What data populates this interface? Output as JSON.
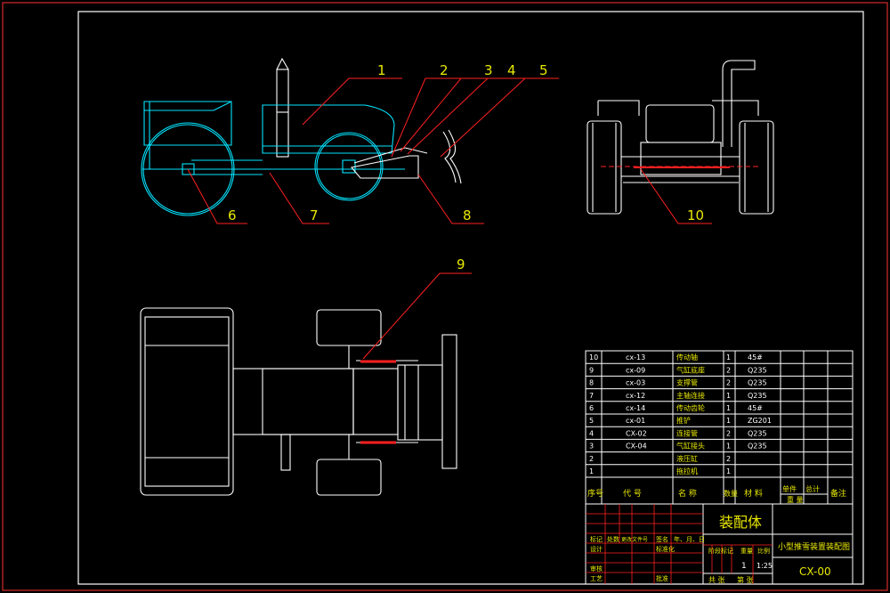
{
  "balloons": [
    {
      "label": "1"
    },
    {
      "label": "2"
    },
    {
      "label": "3"
    },
    {
      "label": "4"
    },
    {
      "label": "5"
    },
    {
      "label": "6"
    },
    {
      "label": "7"
    },
    {
      "label": "8"
    },
    {
      "label": "9"
    },
    {
      "label": "10"
    }
  ],
  "bom": {
    "rows": [
      {
        "seq": "10",
        "code": "cx-13",
        "name": "传动轴",
        "qty": "1",
        "material": "45#"
      },
      {
        "seq": "9",
        "code": "cx-09",
        "name": "气缸底座",
        "qty": "2",
        "material": "Q235"
      },
      {
        "seq": "8",
        "code": "cx-03",
        "name": "支撑管",
        "qty": "2",
        "material": "Q235"
      },
      {
        "seq": "7",
        "code": "cx-12",
        "name": "主轴连接",
        "qty": "1",
        "material": "Q235"
      },
      {
        "seq": "6",
        "code": "cx-14",
        "name": "传动齿轮",
        "qty": "1",
        "material": "45#"
      },
      {
        "seq": "5",
        "code": "cx-01",
        "name": "推铲",
        "qty": "1",
        "material": "ZG201"
      },
      {
        "seq": "4",
        "code": "CX-02",
        "name": "连接管",
        "qty": "2",
        "material": "Q235"
      },
      {
        "seq": "3",
        "code": "CX-04",
        "name": "气缸接头",
        "qty": "1",
        "material": "Q235"
      },
      {
        "seq": "2",
        "code": "",
        "name": "液压缸",
        "qty": "2",
        "material": ""
      },
      {
        "seq": "1",
        "code": "",
        "name": "拖拉机",
        "qty": "1",
        "material": ""
      }
    ],
    "header": {
      "seq": "序号",
      "code": "代  号",
      "name": "名    称",
      "qty": "数量",
      "material": "材  料",
      "unit_top": "单件",
      "total_top": "总计",
      "weight": "重  量",
      "remark": "备注"
    }
  },
  "title_block": {
    "drawing_title": "装配体",
    "product_name": "小型推雪装置装配图",
    "drawing_number": "CX-00",
    "rev_labels": [
      "标记",
      "处数",
      "更改文件号",
      "签名",
      "年、月、日"
    ],
    "sign_labels": [
      "设计",
      "审核",
      "工艺"
    ],
    "sign_labels2": [
      "标准化",
      "批准"
    ],
    "stage_label": "阶段标记",
    "weight_label": "重量",
    "scale_label": "比例",
    "qty_value": "1",
    "scale_value": "1:25",
    "sheet_total": "共  张",
    "sheet_no": "第  张"
  }
}
